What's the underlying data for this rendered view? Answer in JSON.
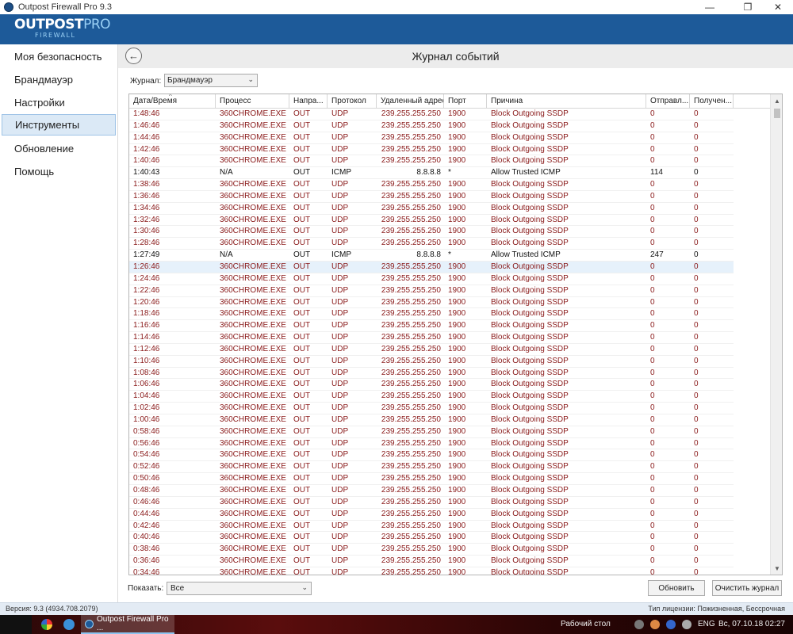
{
  "window": {
    "title": "Outpost Firewall Pro 9.3"
  },
  "logo": {
    "part1": "OUTPOST",
    "part2": "PRO",
    "sub": "FIREWALL"
  },
  "sidebar": {
    "items": [
      {
        "label": "Моя безопасность"
      },
      {
        "label": "Брандмауэр"
      },
      {
        "label": "Настройки"
      },
      {
        "label": "Инструменты"
      },
      {
        "label": "Обновление"
      },
      {
        "label": "Помощь"
      }
    ]
  },
  "main": {
    "title": "Журнал событий",
    "journal_label": "Журнал:",
    "journal_value": "Брандмауэр",
    "show_label": "Показать:",
    "show_value": "Все",
    "refresh_label": "Обновить",
    "clear_label": "Очистить журнал"
  },
  "table": {
    "columns": [
      "Дата/Время",
      "Процесс",
      "Напра...",
      "Протокол",
      "Удаленный адрес",
      "Порт",
      "Причина",
      "Отправл...",
      "Получен..."
    ],
    "rows": [
      [
        "1:48:46",
        "360CHROME.EXE",
        "OUT",
        "UDP",
        "239.255.255.250",
        "1900",
        "Block Outgoing SSDP",
        "0",
        "0"
      ],
      [
        "1:46:46",
        "360CHROME.EXE",
        "OUT",
        "UDP",
        "239.255.255.250",
        "1900",
        "Block Outgoing SSDP",
        "0",
        "0"
      ],
      [
        "1:44:46",
        "360CHROME.EXE",
        "OUT",
        "UDP",
        "239.255.255.250",
        "1900",
        "Block Outgoing SSDP",
        "0",
        "0"
      ],
      [
        "1:42:46",
        "360CHROME.EXE",
        "OUT",
        "UDP",
        "239.255.255.250",
        "1900",
        "Block Outgoing SSDP",
        "0",
        "0"
      ],
      [
        "1:40:46",
        "360CHROME.EXE",
        "OUT",
        "UDP",
        "239.255.255.250",
        "1900",
        "Block Outgoing SSDP",
        "0",
        "0"
      ],
      [
        "1:40:43",
        "N/A",
        "OUT",
        "ICMP",
        "8.8.8.8",
        "*",
        "Allow Trusted ICMP",
        "114",
        "0"
      ],
      [
        "1:38:46",
        "360CHROME.EXE",
        "OUT",
        "UDP",
        "239.255.255.250",
        "1900",
        "Block Outgoing SSDP",
        "0",
        "0"
      ],
      [
        "1:36:46",
        "360CHROME.EXE",
        "OUT",
        "UDP",
        "239.255.255.250",
        "1900",
        "Block Outgoing SSDP",
        "0",
        "0"
      ],
      [
        "1:34:46",
        "360CHROME.EXE",
        "OUT",
        "UDP",
        "239.255.255.250",
        "1900",
        "Block Outgoing SSDP",
        "0",
        "0"
      ],
      [
        "1:32:46",
        "360CHROME.EXE",
        "OUT",
        "UDP",
        "239.255.255.250",
        "1900",
        "Block Outgoing SSDP",
        "0",
        "0"
      ],
      [
        "1:30:46",
        "360CHROME.EXE",
        "OUT",
        "UDP",
        "239.255.255.250",
        "1900",
        "Block Outgoing SSDP",
        "0",
        "0"
      ],
      [
        "1:28:46",
        "360CHROME.EXE",
        "OUT",
        "UDP",
        "239.255.255.250",
        "1900",
        "Block Outgoing SSDP",
        "0",
        "0"
      ],
      [
        "1:27:49",
        "N/A",
        "OUT",
        "ICMP",
        "8.8.8.8",
        "*",
        "Allow Trusted ICMP",
        "247",
        "0"
      ],
      [
        "1:26:46",
        "360CHROME.EXE",
        "OUT",
        "UDP",
        "239.255.255.250",
        "1900",
        "Block Outgoing SSDP",
        "0",
        "0"
      ],
      [
        "1:24:46",
        "360CHROME.EXE",
        "OUT",
        "UDP",
        "239.255.255.250",
        "1900",
        "Block Outgoing SSDP",
        "0",
        "0"
      ],
      [
        "1:22:46",
        "360CHROME.EXE",
        "OUT",
        "UDP",
        "239.255.255.250",
        "1900",
        "Block Outgoing SSDP",
        "0",
        "0"
      ],
      [
        "1:20:46",
        "360CHROME.EXE",
        "OUT",
        "UDP",
        "239.255.255.250",
        "1900",
        "Block Outgoing SSDP",
        "0",
        "0"
      ],
      [
        "1:18:46",
        "360CHROME.EXE",
        "OUT",
        "UDP",
        "239.255.255.250",
        "1900",
        "Block Outgoing SSDP",
        "0",
        "0"
      ],
      [
        "1:16:46",
        "360CHROME.EXE",
        "OUT",
        "UDP",
        "239.255.255.250",
        "1900",
        "Block Outgoing SSDP",
        "0",
        "0"
      ],
      [
        "1:14:46",
        "360CHROME.EXE",
        "OUT",
        "UDP",
        "239.255.255.250",
        "1900",
        "Block Outgoing SSDP",
        "0",
        "0"
      ],
      [
        "1:12:46",
        "360CHROME.EXE",
        "OUT",
        "UDP",
        "239.255.255.250",
        "1900",
        "Block Outgoing SSDP",
        "0",
        "0"
      ],
      [
        "1:10:46",
        "360CHROME.EXE",
        "OUT",
        "UDP",
        "239.255.255.250",
        "1900",
        "Block Outgoing SSDP",
        "0",
        "0"
      ],
      [
        "1:08:46",
        "360CHROME.EXE",
        "OUT",
        "UDP",
        "239.255.255.250",
        "1900",
        "Block Outgoing SSDP",
        "0",
        "0"
      ],
      [
        "1:06:46",
        "360CHROME.EXE",
        "OUT",
        "UDP",
        "239.255.255.250",
        "1900",
        "Block Outgoing SSDP",
        "0",
        "0"
      ],
      [
        "1:04:46",
        "360CHROME.EXE",
        "OUT",
        "UDP",
        "239.255.255.250",
        "1900",
        "Block Outgoing SSDP",
        "0",
        "0"
      ],
      [
        "1:02:46",
        "360CHROME.EXE",
        "OUT",
        "UDP",
        "239.255.255.250",
        "1900",
        "Block Outgoing SSDP",
        "0",
        "0"
      ],
      [
        "1:00:46",
        "360CHROME.EXE",
        "OUT",
        "UDP",
        "239.255.255.250",
        "1900",
        "Block Outgoing SSDP",
        "0",
        "0"
      ],
      [
        "0:58:46",
        "360CHROME.EXE",
        "OUT",
        "UDP",
        "239.255.255.250",
        "1900",
        "Block Outgoing SSDP",
        "0",
        "0"
      ],
      [
        "0:56:46",
        "360CHROME.EXE",
        "OUT",
        "UDP",
        "239.255.255.250",
        "1900",
        "Block Outgoing SSDP",
        "0",
        "0"
      ],
      [
        "0:54:46",
        "360CHROME.EXE",
        "OUT",
        "UDP",
        "239.255.255.250",
        "1900",
        "Block Outgoing SSDP",
        "0",
        "0"
      ],
      [
        "0:52:46",
        "360CHROME.EXE",
        "OUT",
        "UDP",
        "239.255.255.250",
        "1900",
        "Block Outgoing SSDP",
        "0",
        "0"
      ],
      [
        "0:50:46",
        "360CHROME.EXE",
        "OUT",
        "UDP",
        "239.255.255.250",
        "1900",
        "Block Outgoing SSDP",
        "0",
        "0"
      ],
      [
        "0:48:46",
        "360CHROME.EXE",
        "OUT",
        "UDP",
        "239.255.255.250",
        "1900",
        "Block Outgoing SSDP",
        "0",
        "0"
      ],
      [
        "0:46:46",
        "360CHROME.EXE",
        "OUT",
        "UDP",
        "239.255.255.250",
        "1900",
        "Block Outgoing SSDP",
        "0",
        "0"
      ],
      [
        "0:44:46",
        "360CHROME.EXE",
        "OUT",
        "UDP",
        "239.255.255.250",
        "1900",
        "Block Outgoing SSDP",
        "0",
        "0"
      ],
      [
        "0:42:46",
        "360CHROME.EXE",
        "OUT",
        "UDP",
        "239.255.255.250",
        "1900",
        "Block Outgoing SSDP",
        "0",
        "0"
      ],
      [
        "0:40:46",
        "360CHROME.EXE",
        "OUT",
        "UDP",
        "239.255.255.250",
        "1900",
        "Block Outgoing SSDP",
        "0",
        "0"
      ],
      [
        "0:38:46",
        "360CHROME.EXE",
        "OUT",
        "UDP",
        "239.255.255.250",
        "1900",
        "Block Outgoing SSDP",
        "0",
        "0"
      ],
      [
        "0:36:46",
        "360CHROME.EXE",
        "OUT",
        "UDP",
        "239.255.255.250",
        "1900",
        "Block Outgoing SSDP",
        "0",
        "0"
      ],
      [
        "0:34:46",
        "360CHROME.EXE",
        "OUT",
        "UDP",
        "239.255.255.250",
        "1900",
        "Block Outgoing SSDP",
        "0",
        "0"
      ]
    ],
    "selected_row": 13
  },
  "status": {
    "version": "Версия: 9.3 (4934.708.2079)",
    "license": "Тип лицензии: Пожизненная, Бессрочная"
  },
  "taskbar": {
    "app_label": "Outpost Firewall Pro ...",
    "desktop_label": "Рабочий стол",
    "lang": "ENG",
    "clock": "Вс, 07.10.18 02:27"
  },
  "colors": {
    "header_bg": "#1d5a99",
    "block_text": "#8a1a1a",
    "allow_text": "#111111",
    "selected_nav_bg": "#dbe9f6"
  }
}
